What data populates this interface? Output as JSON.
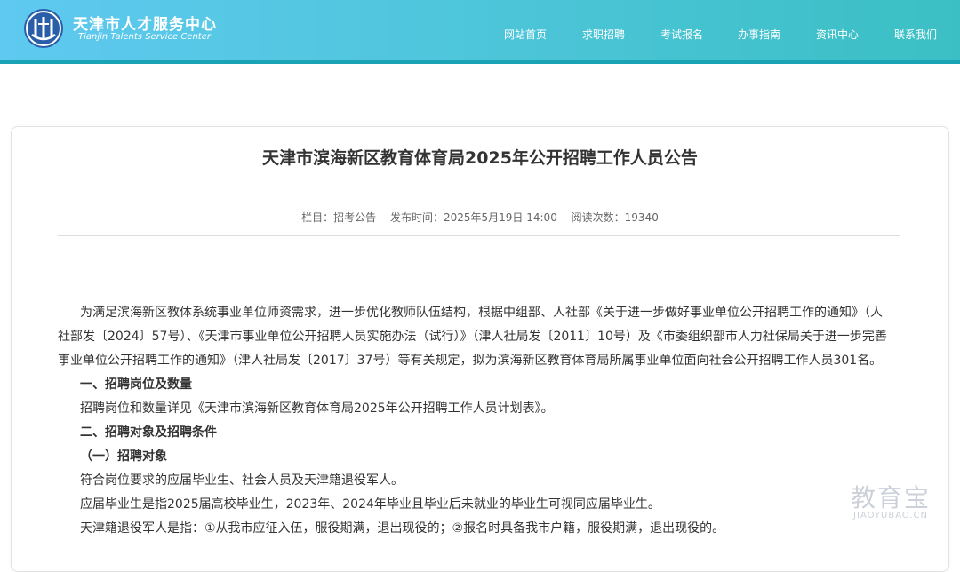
{
  "header": {
    "org_name_cn": "天津市人才服务中心",
    "org_name_en": "Tianjin Talents Service Center",
    "nav": [
      "网站首页",
      "求职招聘",
      "考试报名",
      "办事指南",
      "资讯中心",
      "联系我们"
    ]
  },
  "article": {
    "title": "天津市滨海新区教育体育局2025年公开招聘工作人员公告",
    "meta": {
      "column": "栏目：招考公告",
      "publish_time": "发布时间：2025年5月19日 14:00",
      "read_count": "阅读次数：19340"
    },
    "paragraphs": [
      "为满足滨海新区教体系统事业单位师资需求，进一步优化教师队伍结构，根据中组部、人社部《关于进一步做好事业单位公开招聘工作的通知》（人社部发〔2024〕57号）、《天津市事业单位公开招聘人员实施办法（试行）》（津人社局发〔2011〕10号）及《市委组织部市人力社保局关于进一步完善事业单位公开招聘工作的通知》（津人社局发〔2017〕37号）等有关规定，拟为滨海新区教育体育局所属事业单位面向社会公开招聘工作人员301名。",
      "一、招聘岗位及数量",
      "招聘岗位和数量详见《天津市滨海新区教育体育局2025年公开招聘工作人员计划表》。",
      "二、招聘对象及招聘条件",
      "（一）招聘对象",
      "符合岗位要求的应届毕业生、社会人员及天津籍退役军人。",
      "应届毕业生是指2025届高校毕业生，2023年、2024年毕业且毕业后未就业的毕业生可视同应届毕业生。",
      "天津籍退役军人是指：①从我市应征入伍，服役期满，退出现役的；②报名时具备我市户籍，服役期满，退出现役的。"
    ]
  },
  "watermark": {
    "cn": "教育宝",
    "en": "JIAOYUBAO.CN"
  }
}
